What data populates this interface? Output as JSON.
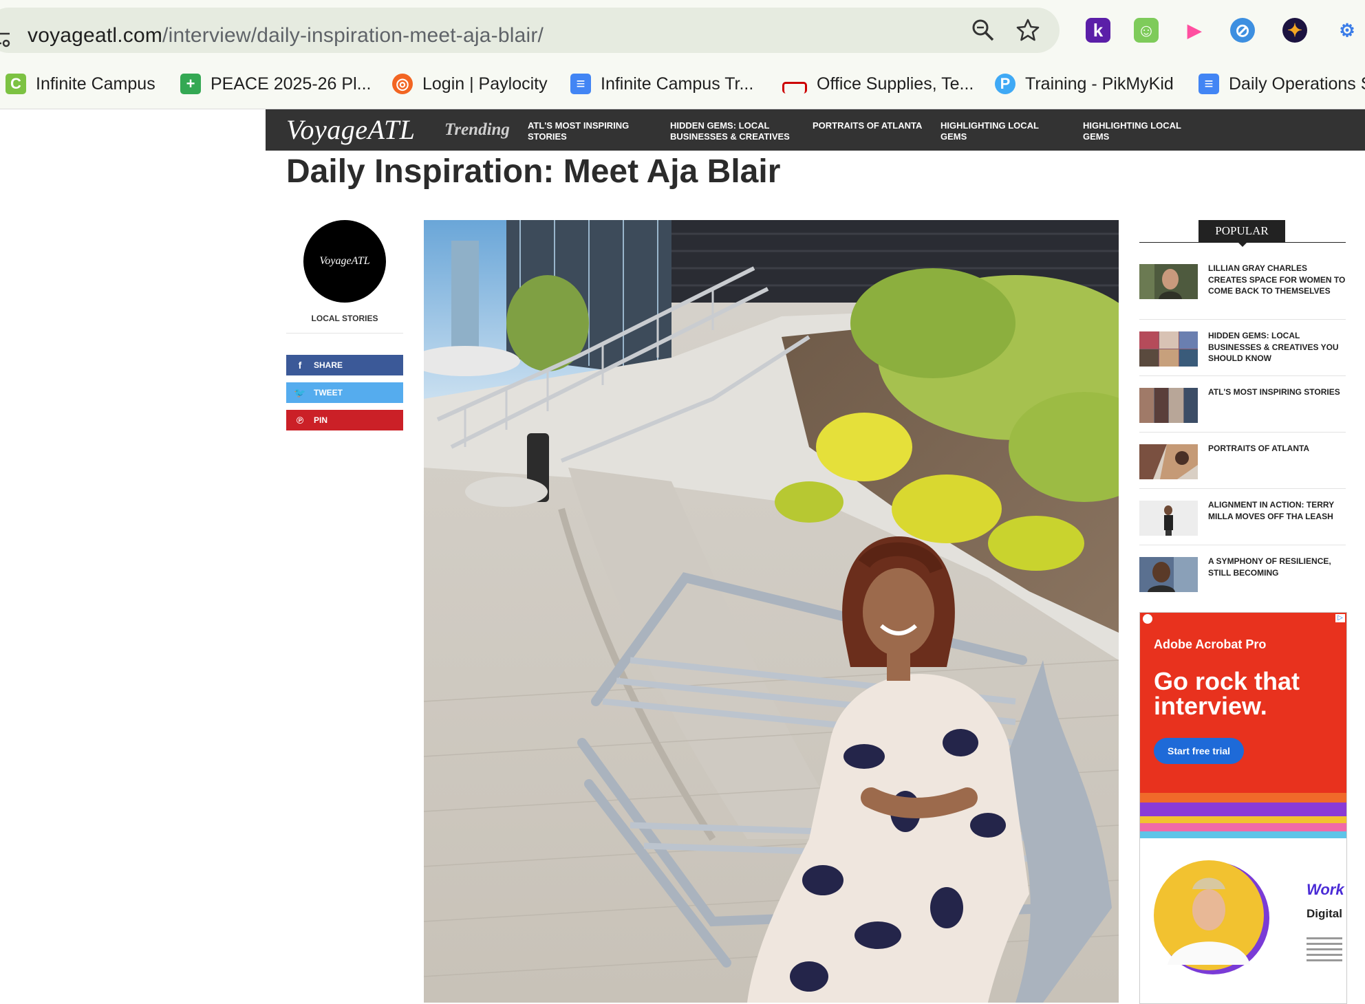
{
  "browser": {
    "url_host": "voyageatl.com",
    "url_path": "/interview/daily-inspiration-meet-aja-blair/",
    "extensions": [
      "k-extension-icon",
      "face-extension-icon",
      "media-extension-icon",
      "link-extension-icon",
      "compass-extension-icon",
      "puzzle-extension-icon"
    ],
    "bookmarks": [
      {
        "label": "Infinite Campus",
        "icon": "campus-icon",
        "color": "#7cc242"
      },
      {
        "label": "PEACE 2025-26 Pl...",
        "icon": "sheets-icon",
        "color": "#34a853"
      },
      {
        "label": "Login | Paylocity",
        "icon": "paylocity-icon",
        "color": "#f26522"
      },
      {
        "label": "Infinite Campus Tr...",
        "icon": "docs-icon",
        "color": "#4285f4"
      },
      {
        "label": "Office Supplies, Te...",
        "icon": "office-icon",
        "color": "#cc0000"
      },
      {
        "label": "Training - PikMyKid",
        "icon": "pikmykid-icon",
        "color": "#3fa9f5"
      },
      {
        "label": "Daily Operations S",
        "icon": "docs-icon",
        "color": "#4285f4"
      }
    ]
  },
  "site": {
    "logo": "VoyageATL",
    "trending_label": "Trending",
    "nav": [
      "ATL'S MOST INSPIRING STORIES",
      "HIDDEN GEMS: LOCAL BUSINESSES & CREATIVES",
      "PORTRAITS OF ATLANTA",
      "HIGHLIGHTING LOCAL GEMS",
      "HIGHLIGHTING LOCAL GEMS"
    ]
  },
  "article": {
    "title": "Daily Inspiration: Meet Aja Blair",
    "author_logo": "VoyageATL",
    "author": "LOCAL STORIES",
    "share": [
      {
        "label": "SHARE",
        "icon": "facebook-icon",
        "glyph": "f",
        "color": "#3b5998"
      },
      {
        "label": "TWEET",
        "icon": "twitter-icon",
        "glyph": "🐦",
        "color": "#55acee"
      },
      {
        "label": "PIN",
        "icon": "pinterest-icon",
        "glyph": "℗",
        "color": "#cb2027"
      }
    ]
  },
  "sidebar": {
    "popular_label": "POPULAR",
    "items": [
      {
        "title": "LILLIAN GRAY CHARLES CREATES SPACE FOR WOMEN TO COME BACK TO THEMSELVES",
        "thumb": "portrait-thumbnail"
      },
      {
        "title": "HIDDEN GEMS: LOCAL BUSINESSES & CREATIVES YOU SHOULD KNOW",
        "thumb": "collage-thumbnail"
      },
      {
        "title": "ATL'S MOST INSPIRING STORIES",
        "thumb": "collage-thumbnail"
      },
      {
        "title": "PORTRAITS OF ATLANTA",
        "thumb": "collage-thumbnail"
      },
      {
        "title": "ALIGNMENT IN ACTION: TERRY MILLA MOVES OFF THA LEASH",
        "thumb": "portrait-thumbnail"
      },
      {
        "title": "A SYMPHONY OF RESILIENCE, STILL BECOMING",
        "thumb": "portrait-thumbnail"
      }
    ],
    "ad": {
      "brand": "Adobe Acrobat Pro",
      "headline": "Go rock that interview.",
      "cta": "Start free trial",
      "work_text": "Work",
      "digital_text": "Digital"
    }
  }
}
